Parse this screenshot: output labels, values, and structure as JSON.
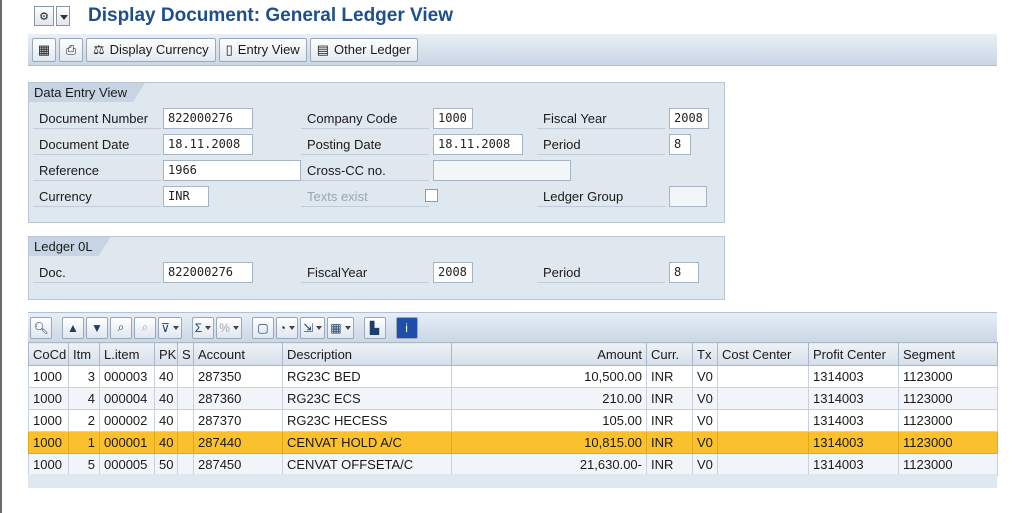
{
  "title": "Display Document: General Ledger View",
  "toolbar": {
    "display_currency": "Display Currency",
    "entry_view": "Entry View",
    "other_ledger": "Other Ledger"
  },
  "data_entry": {
    "group_title": "Data Entry View",
    "document_number_label": "Document Number",
    "document_number": "822000276",
    "company_code_label": "Company Code",
    "company_code": "1000",
    "fiscal_year_label": "Fiscal Year",
    "fiscal_year": "2008",
    "document_date_label": "Document Date",
    "document_date": "18.11.2008",
    "posting_date_label": "Posting Date",
    "posting_date": "18.11.2008",
    "period_label": "Period",
    "period": "8",
    "reference_label": "Reference",
    "reference": "1966",
    "cross_cc_label": "Cross-CC no.",
    "cross_cc": "",
    "currency_label": "Currency",
    "currency": "INR",
    "texts_exist_label": "Texts exist",
    "ledger_group_label": "Ledger Group",
    "ledger_group": ""
  },
  "ledger": {
    "group_title": "Ledger 0L",
    "doc_label": "Doc.",
    "doc": "822000276",
    "fiscal_year_label": "FiscalYear",
    "fiscal_year": "2008",
    "period_label": "Period",
    "period": "8"
  },
  "grid": {
    "columns": [
      "CoCd",
      "Itm",
      "L.item",
      "PK",
      "S",
      "Account",
      "Description",
      "Amount",
      "Curr.",
      "Tx",
      "Cost Center",
      "Profit Center",
      "Segment"
    ],
    "rows": [
      {
        "cocd": "1000",
        "itm": "3",
        "litem": "000003",
        "pk": "40",
        "s": "",
        "account": "287350",
        "desc": "RG23C BED",
        "amount": "10,500.00",
        "curr": "INR",
        "tx": "V0",
        "cc": "",
        "pc": "1314003",
        "seg": "1123000"
      },
      {
        "cocd": "1000",
        "itm": "4",
        "litem": "000004",
        "pk": "40",
        "s": "",
        "account": "287360",
        "desc": "RG23C ECS",
        "amount": "210.00",
        "curr": "INR",
        "tx": "V0",
        "cc": "",
        "pc": "1314003",
        "seg": "1123000"
      },
      {
        "cocd": "1000",
        "itm": "2",
        "litem": "000002",
        "pk": "40",
        "s": "",
        "account": "287370",
        "desc": "RG23C HECESS",
        "amount": "105.00",
        "curr": "INR",
        "tx": "V0",
        "cc": "",
        "pc": "1314003",
        "seg": "1123000"
      },
      {
        "cocd": "1000",
        "itm": "1",
        "litem": "000001",
        "pk": "40",
        "s": "",
        "account": "287440",
        "desc": "CENVAT HOLD A/C",
        "amount": "10,815.00",
        "curr": "INR",
        "tx": "V0",
        "cc": "",
        "pc": "1314003",
        "seg": "1123000"
      },
      {
        "cocd": "1000",
        "itm": "5",
        "litem": "000005",
        "pk": "50",
        "s": "",
        "account": "287450",
        "desc": "CENVAT OFFSETA/C",
        "amount": "21,630.00-",
        "curr": "INR",
        "tx": "V0",
        "cc": "",
        "pc": "1314003",
        "seg": "1123000"
      }
    ]
  },
  "colors": {
    "title": "#1f4e8c",
    "selected_row": "#fbc02d",
    "group_bg": "#dfe7ef"
  }
}
